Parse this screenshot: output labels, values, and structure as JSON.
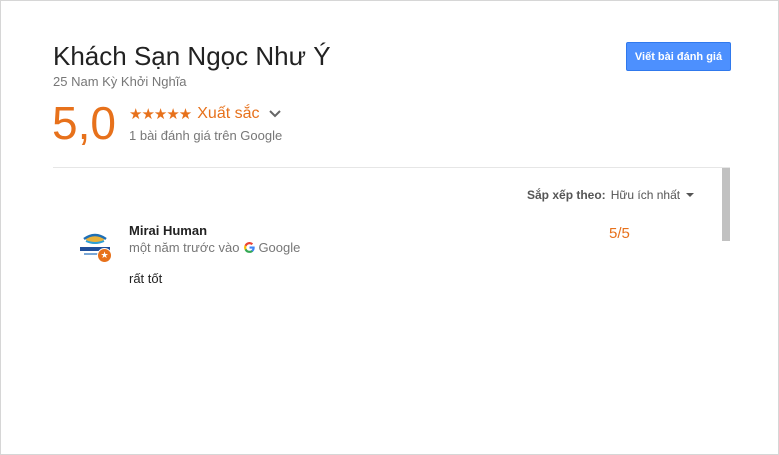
{
  "hotel": {
    "name": "Khách Sạn Ngọc Như Ý",
    "address": "25 Nam Kỳ Khởi Nghĩa"
  },
  "write_review_button": "Viết bài đánh giá",
  "summary": {
    "score": "5,0",
    "stars_glyphs": "★★★★★",
    "star_rating": 5,
    "rating_word": "Xuất sắc",
    "review_count": "1 bài đánh giá trên Google"
  },
  "sort": {
    "label": "Sắp xếp theo:",
    "value": "Hữu ích nhất"
  },
  "reviews": [
    {
      "author": "Mirai Human",
      "time": "một năm trước vào",
      "source": "Google",
      "score": "5/5",
      "text": "rất tốt",
      "badge": "★"
    }
  ],
  "colors": {
    "accent": "#e7711b",
    "button": "#4d90fe",
    "muted": "#777777"
  },
  "icons": {
    "chevron": "chevron-down-icon",
    "google": "google-g-icon",
    "badge": "local-guide-star-icon"
  }
}
